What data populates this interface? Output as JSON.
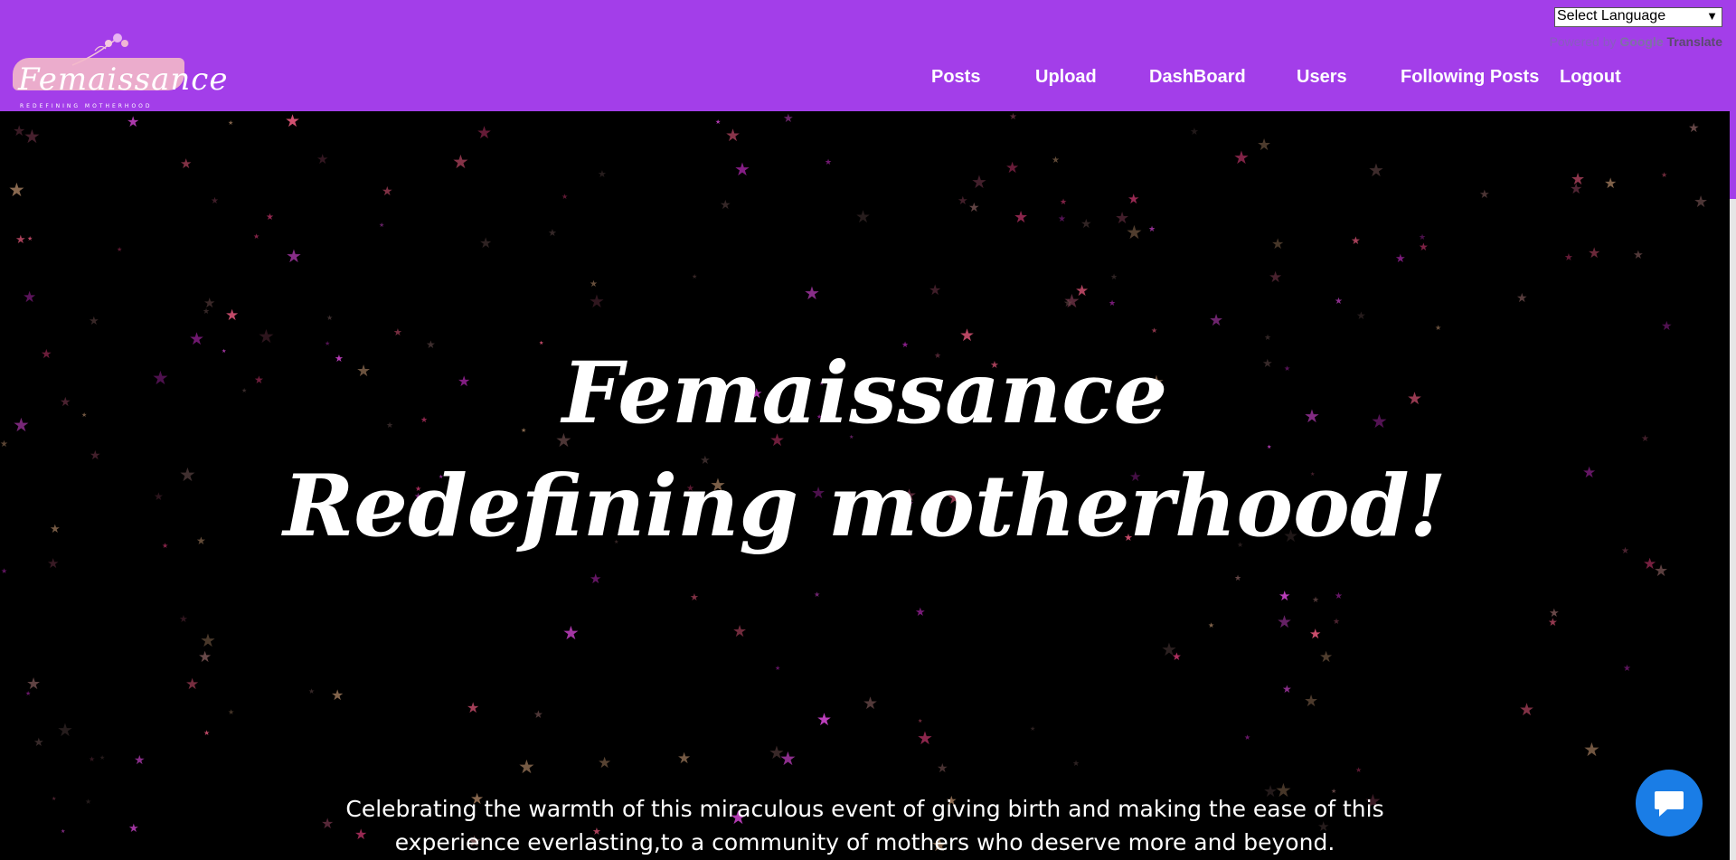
{
  "header": {
    "logo_text": "Femaissance",
    "logo_subtitle": "REDEFINING MOTHERHOOD",
    "nav": [
      {
        "label": "Posts"
      },
      {
        "label": "Upload"
      },
      {
        "label": "DashBoard"
      },
      {
        "label": "Users"
      },
      {
        "label": "Following Posts"
      },
      {
        "label": "Logout"
      }
    ],
    "language_select": "Select Language",
    "powered_by": "Powered by",
    "google": "Google",
    "translate": "Translate"
  },
  "hero": {
    "title_line1": "Femaissance",
    "title_line2": "Redefining motherhood!",
    "tagline": "Celebrating the warmth of this miraculous event of giving birth and making the ease of this experience everlasting,to a community of mothers who deserve more and beyond."
  },
  "colors": {
    "header_bg": "#a33ee9",
    "background": "#000000",
    "chat_button": "#1a7de6"
  },
  "icons": {
    "chat": "chat-bubble-icon",
    "logo_flower": "flower-icon"
  }
}
